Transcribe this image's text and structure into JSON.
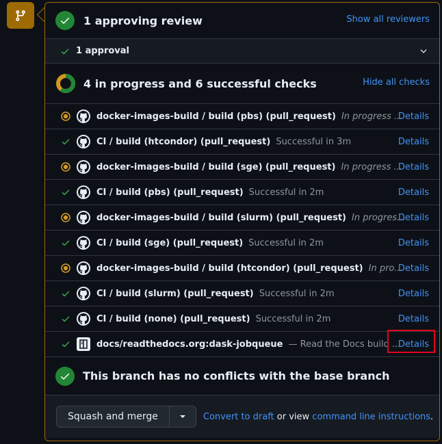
{
  "gutter": {
    "icon": "git-branch-icon"
  },
  "review": {
    "title": "1 approving review",
    "show_reviewers": "Show all reviewers",
    "approvals_label": "1 approval"
  },
  "checks": {
    "title": "4 in progress and 6 successful checks",
    "hide_all": "Hide all checks",
    "progress_fraction": 0.6,
    "rows": [
      {
        "status": "in-progress",
        "name": "docker-images-build / build (pbs) (pull_request)",
        "desc": "In progress ...",
        "details": "Details"
      },
      {
        "status": "success",
        "name": "CI / build (htcondor) (pull_request)",
        "desc": "Successful in 3m",
        "details": "Details"
      },
      {
        "status": "in-progress",
        "name": "docker-images-build / build (sge) (pull_request)",
        "desc": "In progress ...",
        "details": "Details"
      },
      {
        "status": "success",
        "name": "CI / build (pbs) (pull_request)",
        "desc": "Successful in 2m",
        "details": "Details"
      },
      {
        "status": "in-progress",
        "name": "docker-images-build / build (slurm) (pull_request)",
        "desc": "In progres...",
        "details": "Details"
      },
      {
        "status": "success",
        "name": "CI / build (sge) (pull_request)",
        "desc": "Successful in 2m",
        "details": "Details"
      },
      {
        "status": "in-progress",
        "name": "docker-images-build / build (htcondor) (pull_request)",
        "desc": "In pro...",
        "details": "Details"
      },
      {
        "status": "success",
        "name": "CI / build (slurm) (pull_request)",
        "desc": "Successful in 2m",
        "details": "Details"
      },
      {
        "status": "success",
        "name": "CI / build (none) (pull_request)",
        "desc": "Successful in 2m",
        "details": "Details"
      },
      {
        "status": "success",
        "name": "docs/readthedocs.org:dask-jobqueue",
        "desc": "— Read the Docs build ...",
        "details": "Details"
      }
    ]
  },
  "conflicts": {
    "title": "This branch has no conflicts with the base branch"
  },
  "merge": {
    "button_label": "Squash and merge",
    "convert_link": "Convert to draft",
    "or_view": "or view",
    "cli_link": "command line instructions",
    "period": "."
  },
  "colors": {
    "success": "#3fb950",
    "in_progress": "#d29922",
    "accent": "#9e6a03",
    "link": "#4493f8",
    "highlight": "#e5001f"
  }
}
